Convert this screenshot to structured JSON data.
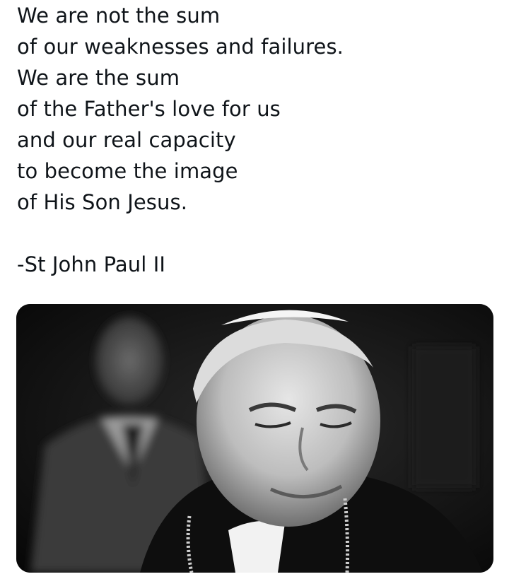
{
  "post": {
    "lines": [
      "We are not the sum",
      "of our weaknesses and failures.",
      "We are the sum",
      "of the Father's love for us",
      "and our real capacity",
      "to become the image",
      "of His Son Jesus."
    ],
    "attribution": "-St John Paul II"
  },
  "media": {
    "type": "photo",
    "style": "black-and-white",
    "icon": "photo-icon"
  }
}
